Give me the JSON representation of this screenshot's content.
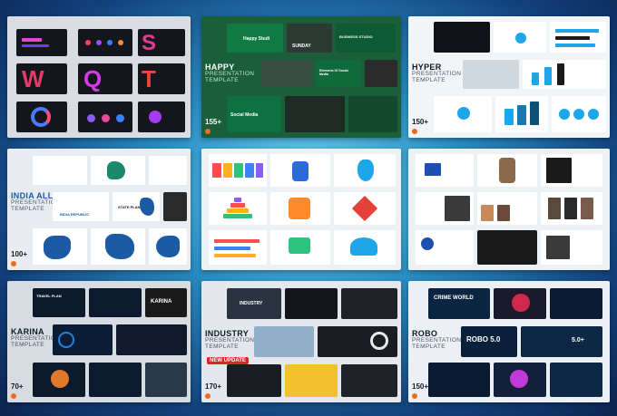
{
  "templates": [
    {
      "title": "",
      "subtitle": "",
      "count": "",
      "labels": []
    },
    {
      "title": "HAPPY",
      "subtitle": "PRESENTATION TEMPLATE",
      "count": "155+",
      "labels": [
        "Happy Studi",
        "SUNDAY",
        "BUSINESS STUDIO",
        "Elements Of Social Media",
        "Social Media"
      ]
    },
    {
      "title": "HYPER",
      "subtitle": "PRESENTATION TEMPLATE",
      "count": "150+",
      "labels": []
    },
    {
      "title": "INDIA ALL MAP",
      "subtitle": "PRESENTATION TEMPLATE",
      "count": "100+",
      "labels": [
        "INDIA REPUBLIC",
        "STATE PLAN"
      ]
    },
    {
      "title": "",
      "subtitle": "",
      "count": "",
      "labels": []
    },
    {
      "title": "",
      "subtitle": "",
      "count": "",
      "labels": []
    },
    {
      "title": "KARINA",
      "subtitle": "PRESENTATION TEMPLATE",
      "count": "70+",
      "labels": [
        "TRAVEL PLAN",
        "KARINA"
      ]
    },
    {
      "title": "INDUSTRY",
      "subtitle": "PRESENTATION TEMPLATE",
      "count": "170+",
      "labels": [
        "INDUSTRY",
        "NEW UPDATE"
      ]
    },
    {
      "title": "ROBO",
      "subtitle": "PRESENTATION TEMPLATE",
      "count": "150+",
      "labels": [
        "CRIME WORLD",
        "ROBO 5.0",
        "5.0+"
      ]
    }
  ],
  "colors": {
    "orange_dot": "#f26a1b",
    "green_card": "#1a5e3a",
    "dark_slide": "#15161c"
  }
}
